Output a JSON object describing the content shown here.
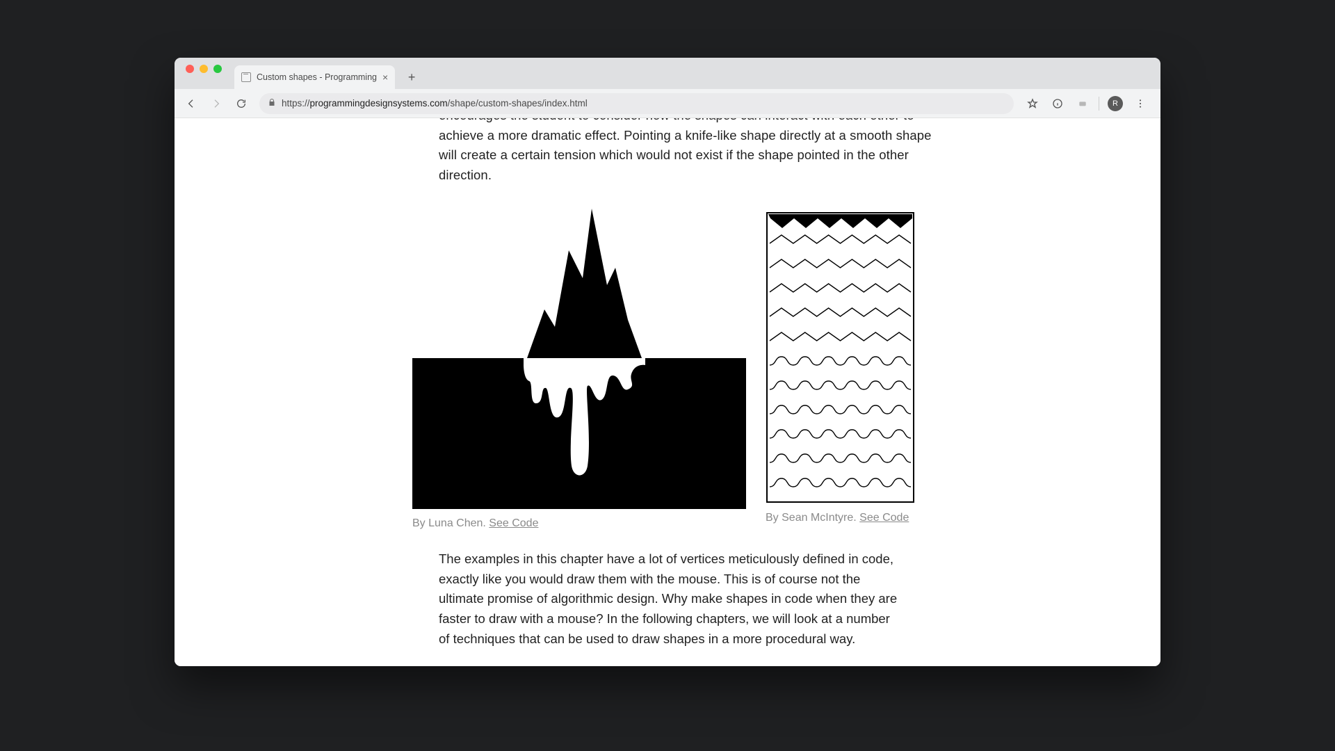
{
  "browser": {
    "tab_title": "Custom shapes - Programming",
    "url_scheme": "https://",
    "url_host": "programmingdesignsystems.com",
    "url_path": "/shape/custom-shapes/index.html",
    "avatar_initial": "R"
  },
  "content": {
    "para1": "encourages the student to consider how the shapes can interact with each other to achieve a more dramatic effect. Pointing a knife-like shape directly at a smooth shape will create a certain tension which would not exist if the shape pointed in the other direction.",
    "fig1_credit": "By Luna Chen. ",
    "fig1_link": "See Code",
    "fig2_credit": "By Sean McIntyre. ",
    "fig2_link": "See Code",
    "para2": "The examples in this chapter have a lot of vertices meticulously defined in code, exactly like you would draw them with the mouse. This is of course not the ultimate promise of algorithmic design. Why make shapes in code when they are faster to draw with a mouse? In the following chapters, we will look at a number of techniques that can be used to draw shapes in a more procedural way."
  }
}
